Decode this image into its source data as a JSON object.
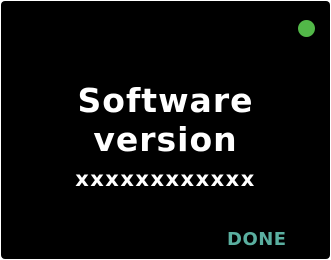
{
  "screen": {
    "title_line1": "Software",
    "title_line2": "version",
    "version_value": "xxxxxxxxxxxx",
    "done_label": "DONE",
    "status_icon": "status-dot-icon"
  },
  "colors": {
    "background": "#000000",
    "text": "#ffffff",
    "status_dot": "#52b848",
    "done_accent": "#5aafa0"
  }
}
